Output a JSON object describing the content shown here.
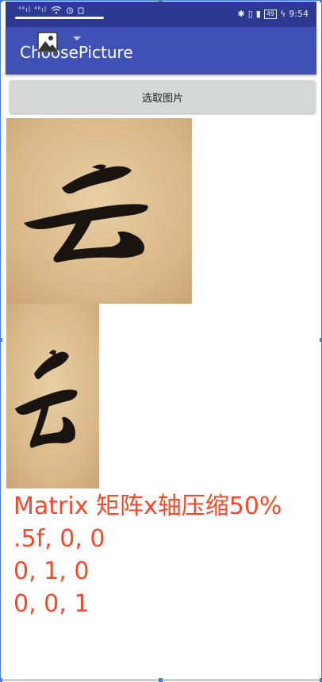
{
  "status_bar": {
    "left_indicators": "⁴⁶ıl ⁴⁶ıl",
    "time": "9:54",
    "battery": "49"
  },
  "app": {
    "title": "ChoosePicture"
  },
  "button": {
    "label": "选取图片"
  },
  "matrix": {
    "lines": [
      "Matrix 矩阵x轴压缩50%",
      ".5f, 0, 0",
      "0, 1, 0",
      "0, 0, 1"
    ]
  },
  "colors": {
    "status_bar": "#2c3a93",
    "app_bar": "#3f51b5",
    "matrix_text": "#f4482d",
    "button_bg": "#d6d7d7"
  }
}
